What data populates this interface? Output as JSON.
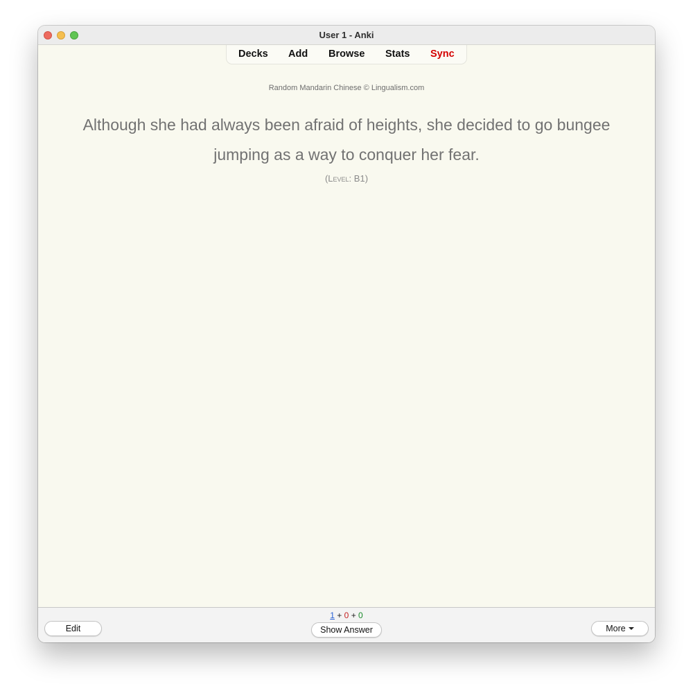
{
  "window": {
    "title": "User 1 - Anki"
  },
  "toolbar": {
    "decks": "Decks",
    "add": "Add",
    "browse": "Browse",
    "stats": "Stats",
    "sync": "Sync",
    "sync_color": "#d40000"
  },
  "card": {
    "credit": "Random Mandarin Chinese © Lingualism.com",
    "sentence": "Although she had always been afraid of heights, she decided to go bungee jumping as a way to conquer her fear.",
    "level_open": "(",
    "level_word": "Level",
    "level_sep": ": ",
    "level_value": "B1",
    "level_close": ")"
  },
  "bottom": {
    "counts": {
      "new": "1",
      "learning": "0",
      "review": "0",
      "plus": "+"
    },
    "edit_label": "Edit",
    "show_answer_label": "Show Answer",
    "more_label": "More",
    "more_icon": "caret-down-icon"
  }
}
